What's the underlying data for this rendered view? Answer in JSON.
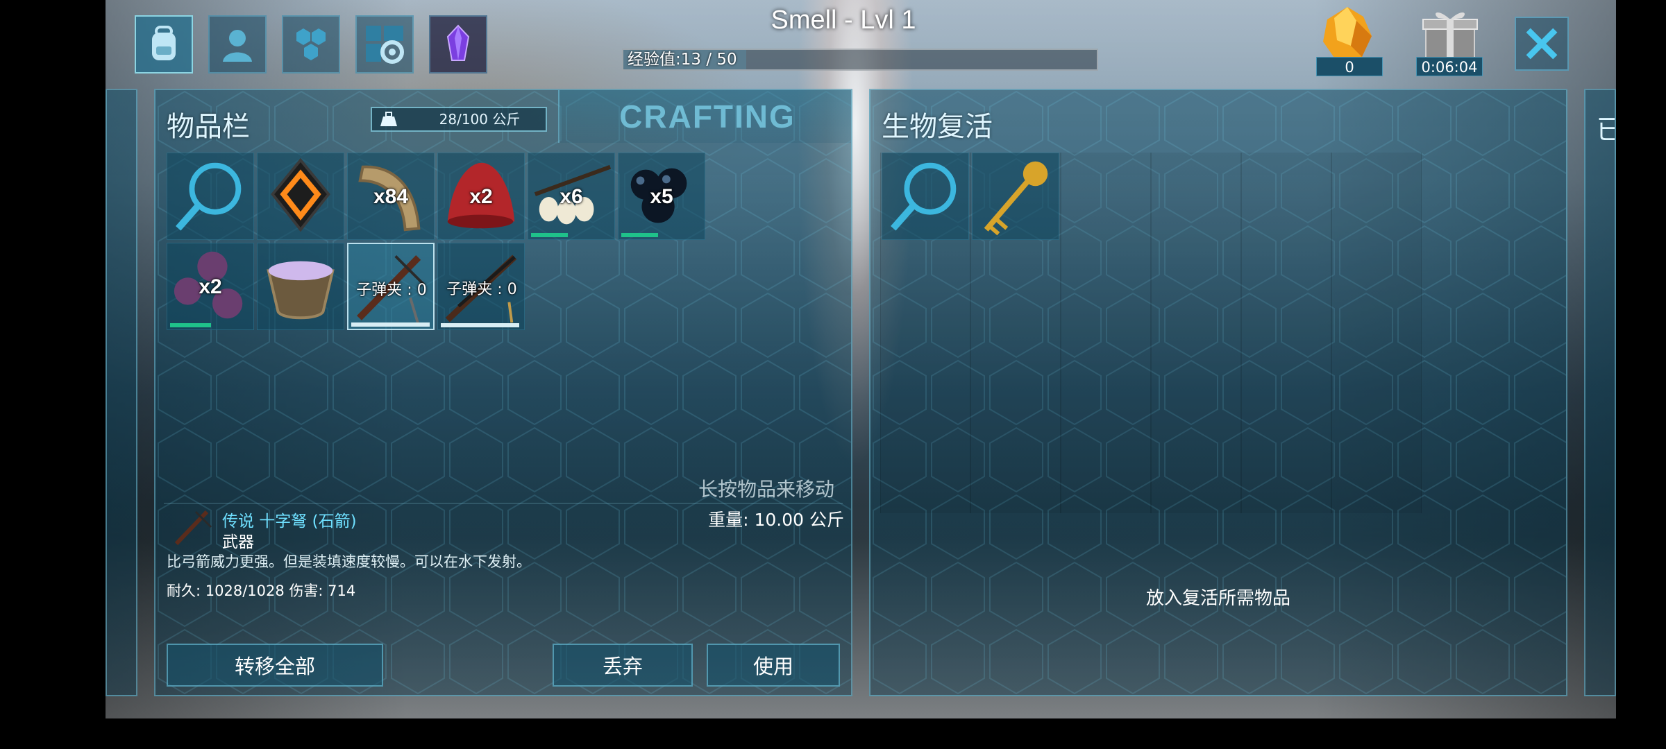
{
  "header": {
    "title": "Smell - Lvl 1",
    "xp_text": "经验值:13 / 50",
    "xp_progress": 0.26
  },
  "top_icons": [
    {
      "name": "backpack-icon",
      "active": true
    },
    {
      "name": "character-icon",
      "active": false
    },
    {
      "name": "tribe-icon",
      "active": false
    },
    {
      "name": "settings-icon",
      "active": false
    },
    {
      "name": "crystal-icon",
      "active": false
    }
  ],
  "top_right": {
    "amber_count": "0",
    "gift_timer": "0:06:04"
  },
  "inventory": {
    "title": "物品栏",
    "weight": "28/100 公斤",
    "crafting_tab": "CRAFTING",
    "slots": [
      {
        "name": "search-slot",
        "qty": "",
        "ammo": "",
        "bar": null
      },
      {
        "name": "implant-slot",
        "qty": "",
        "ammo": "",
        "bar": null
      },
      {
        "name": "wood-slot",
        "qty": "x84",
        "ammo": "",
        "bar": null
      },
      {
        "name": "meat-slot",
        "qty": "x2",
        "ammo": "",
        "bar": null
      },
      {
        "name": "eggs-slot",
        "qty": "x6",
        "ammo": "",
        "bar": {
          "color": "green",
          "fraction": 0.45
        }
      },
      {
        "name": "blackberries-slot",
        "qty": "x5",
        "ammo": "",
        "bar": {
          "color": "green",
          "fraction": 0.45
        }
      },
      {
        "name": "purple-berries-slot",
        "qty": "x2",
        "ammo": "",
        "bar": {
          "color": "green",
          "fraction": 0.5
        }
      },
      {
        "name": "mortar-slot",
        "qty": "",
        "ammo": "",
        "bar": null
      },
      {
        "name": "crossbow-slot",
        "qty": "",
        "ammo": "子弹夹 : 0",
        "bar": {
          "color": "white",
          "fraction": 0.96
        },
        "selected": true
      },
      {
        "name": "shotgun-slot",
        "qty": "",
        "ammo": "子弹夹 : 0",
        "bar": {
          "color": "white",
          "fraction": 0.96
        }
      }
    ],
    "hint": "长按物品来移动",
    "weight_line": "重量: 10.00 公斤",
    "item": {
      "name": "传说 十字弩 (石箭)",
      "type": "武器",
      "description": "比弓箭威力更强。但是装填速度较慢。可以在水下发射。",
      "stats": "耐久: 1028/1028  伤害: 714"
    },
    "buttons": {
      "transfer_all": "转移全部",
      "drop": "丢弃",
      "use": "使用"
    }
  },
  "revive": {
    "title": "生物复活",
    "hint": "放入复活所需物品",
    "edge_label": "已"
  }
}
